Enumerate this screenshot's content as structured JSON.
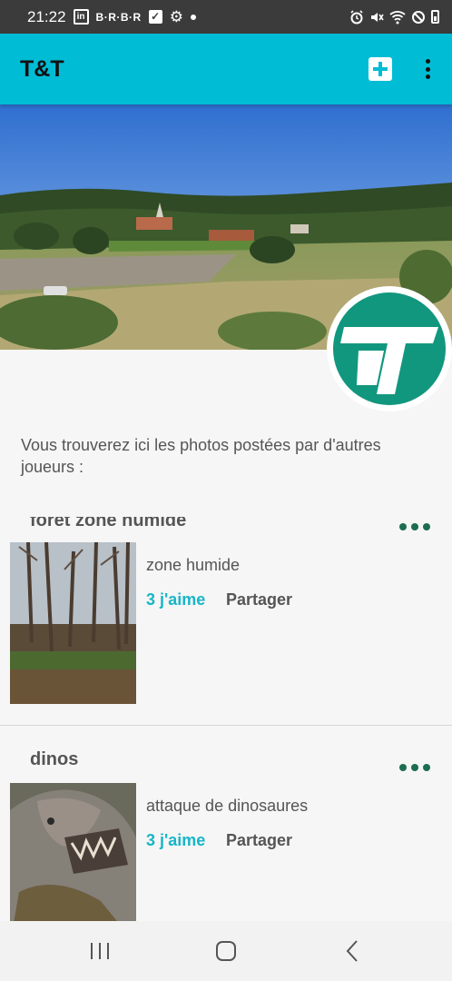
{
  "status_bar": {
    "time": "21:22",
    "linkedin_glyph": "in",
    "brbr_text": "B·R·B·R",
    "icons": [
      "linkedin-icon",
      "brbr-icon",
      "check-icon",
      "gear-icon",
      "dot-icon",
      "alarm-icon",
      "mute-icon",
      "wifi-icon",
      "dnd-icon",
      "battery-icon"
    ]
  },
  "app_bar": {
    "title": "T&T",
    "add_icon": "add-box-icon",
    "more_icon": "more-vert-icon",
    "color": "#00bcd4"
  },
  "intro_text": "Vous trouverez ici les photos postées par d'autres joueurs :",
  "posts": [
    {
      "title": "forêt zone humide",
      "description": "zone humide",
      "likes": "3 j'aime",
      "share": "Partager"
    },
    {
      "title": "dinos",
      "description": "attaque de dinosaures",
      "likes": "3 j'aime",
      "share": "Partager"
    }
  ],
  "colors": {
    "accent": "#00bcd4",
    "likes": "#17b6c8",
    "menu_dots": "#1b6e4f",
    "logo": "#12977f"
  },
  "nav_bar": {
    "icons": [
      "recents-icon",
      "home-icon",
      "back-icon"
    ]
  }
}
